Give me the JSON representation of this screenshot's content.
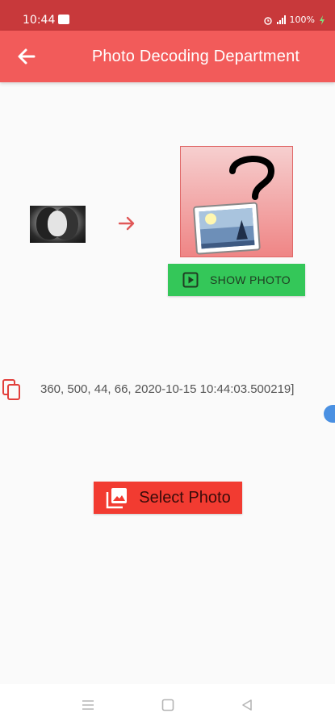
{
  "status_bar": {
    "time": "10:44",
    "battery": "100%"
  },
  "app_bar": {
    "title": "Photo Decoding Department"
  },
  "main": {
    "show_photo_label": "SHOW PHOTO",
    "result_text": "360, 500, 44, 66, 2020-10-15 10:44:03.500219]",
    "select_photo_label": "Select Photo"
  },
  "icons": {
    "back": "arrow-left-icon",
    "arrow": "arrow-right-icon",
    "placeholder": "image-question-icon",
    "play": "play-square-icon",
    "copy": "copy-icon",
    "gallery": "photo-library-icon",
    "nav_menu": "menu-lines-icon",
    "nav_home": "square-icon",
    "nav_back": "triangle-back-icon"
  },
  "colors": {
    "status_bar": "#c8393b",
    "app_bar": "#f25b5a",
    "show_button": "#34c759",
    "select_button": "#f23b31",
    "scroll_handle": "#4a90e2"
  }
}
